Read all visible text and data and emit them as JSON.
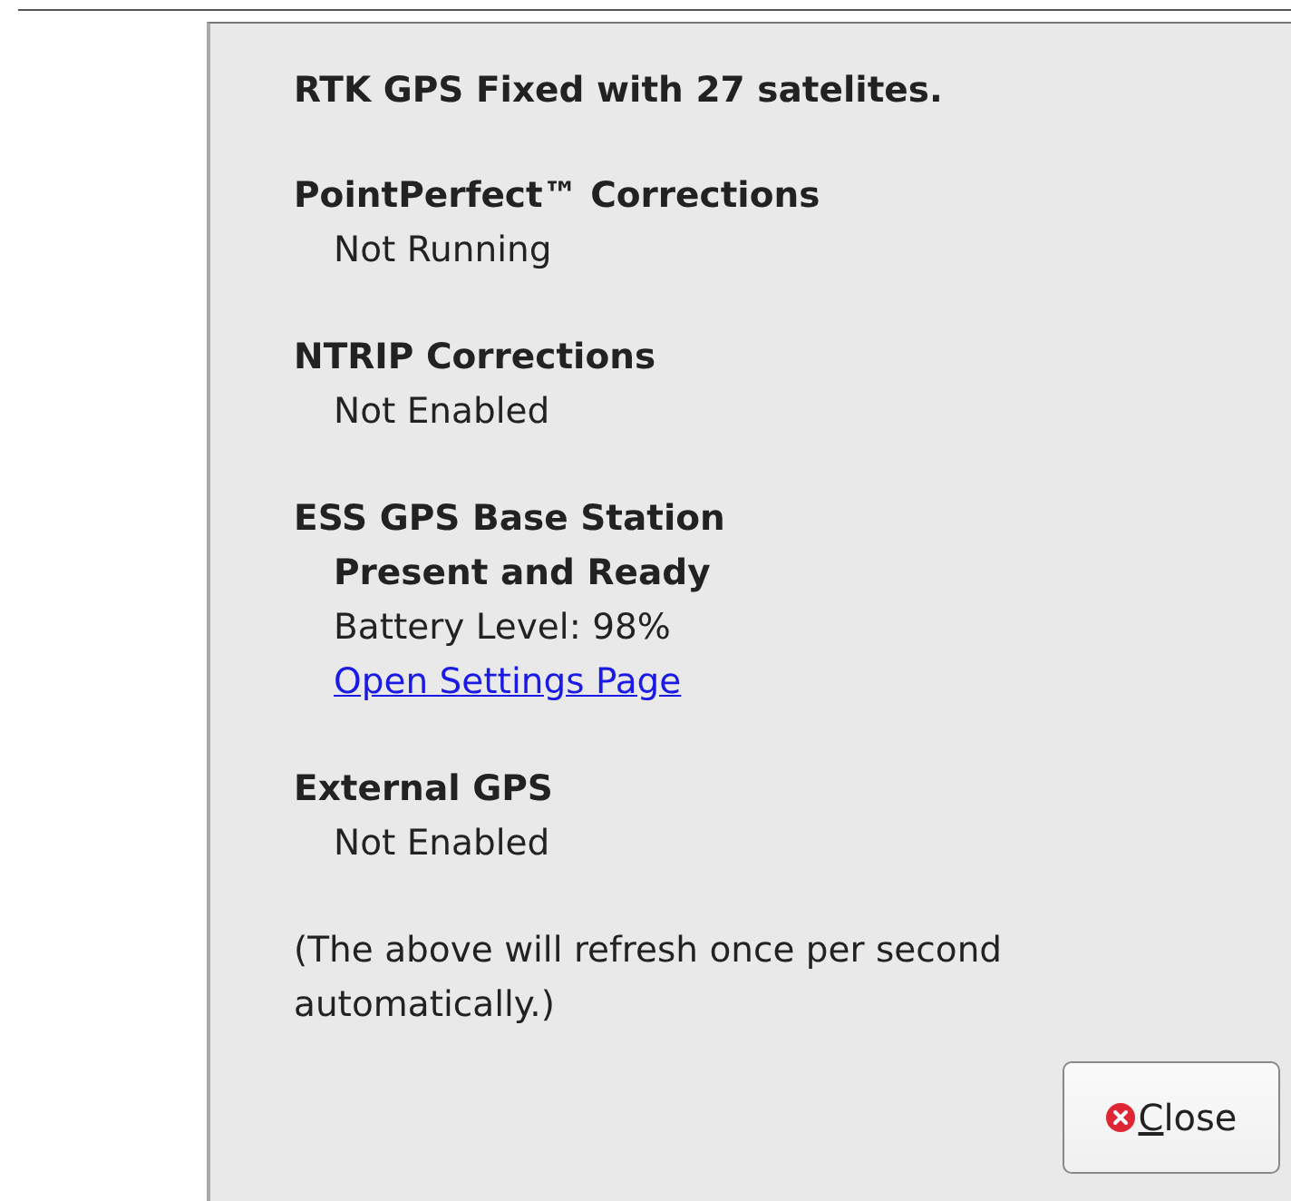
{
  "status_title": "RTK GPS Fixed with 27 satelites.",
  "sections": [
    {
      "heading": "PointPerfect™ Corrections",
      "lines": [
        {
          "kind": "text",
          "text": "Not Running"
        }
      ]
    },
    {
      "heading": "NTRIP Corrections",
      "lines": [
        {
          "kind": "text",
          "text": "Not Enabled"
        }
      ]
    },
    {
      "heading": "ESS GPS Base Station",
      "lines": [
        {
          "kind": "bold",
          "text": "Present and Ready"
        },
        {
          "kind": "text",
          "text": "Battery Level: 98%"
        },
        {
          "kind": "link",
          "text": "Open Settings Page"
        }
      ]
    },
    {
      "heading": "External GPS",
      "lines": [
        {
          "kind": "text",
          "text": "Not Enabled"
        }
      ]
    }
  ],
  "note": "(The above will refresh once per second automatically.)",
  "close_button": "Close"
}
